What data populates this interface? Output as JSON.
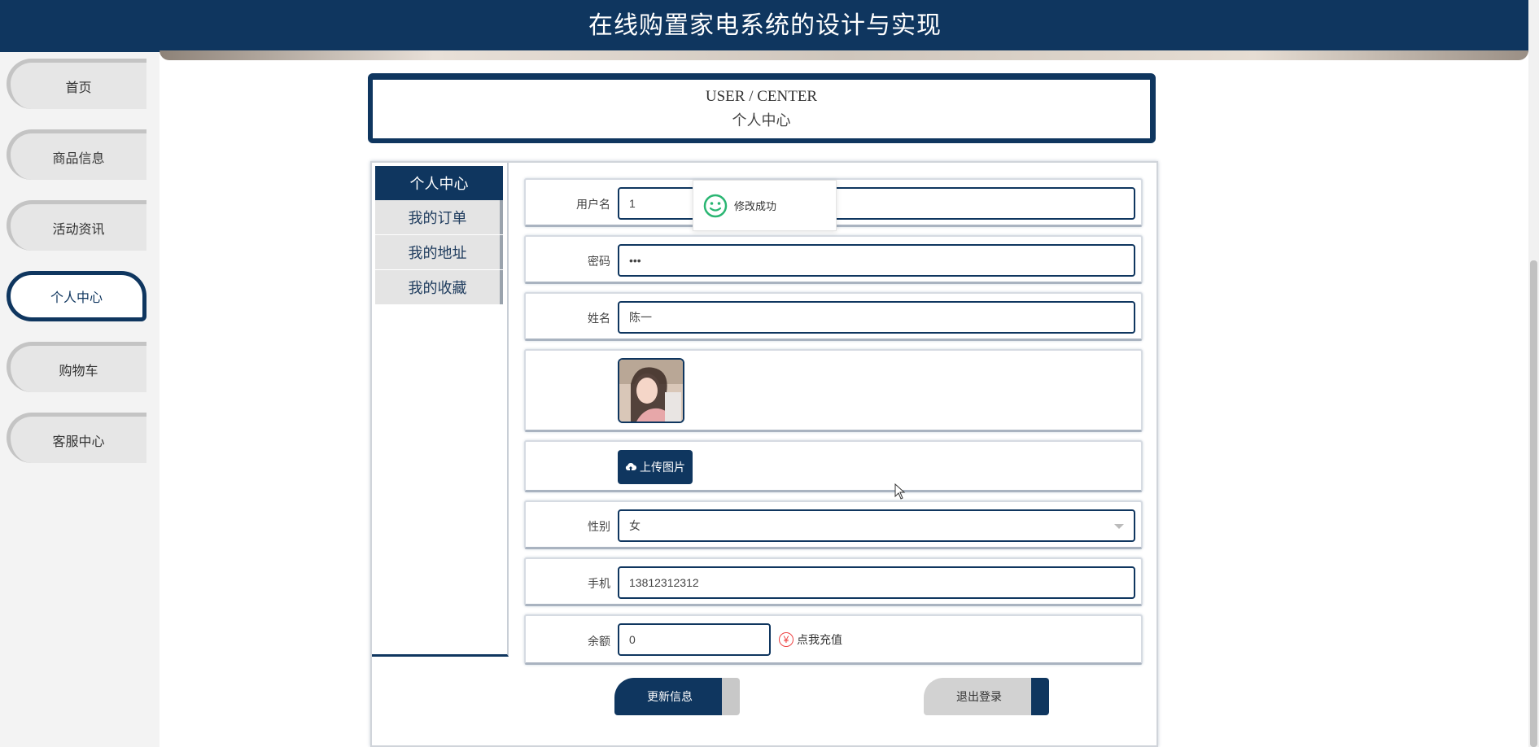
{
  "header": {
    "title": "在线购置家电系统的设计与实现"
  },
  "sidebar": {
    "items": [
      {
        "label": "首页",
        "active": false
      },
      {
        "label": "商品信息",
        "active": false
      },
      {
        "label": "活动资讯",
        "active": false
      },
      {
        "label": "个人中心",
        "active": true
      },
      {
        "label": "购物车",
        "active": false
      },
      {
        "label": "客服中心",
        "active": false
      }
    ]
  },
  "page_header": {
    "en": "USER / CENTER",
    "cn": "个人中心"
  },
  "menu": {
    "items": [
      {
        "label": "个人中心",
        "active": true
      },
      {
        "label": "我的订单",
        "active": false
      },
      {
        "label": "我的地址",
        "active": false
      },
      {
        "label": "我的收藏",
        "active": false
      }
    ]
  },
  "form": {
    "username": {
      "label": "用户名",
      "value": "1"
    },
    "password": {
      "label": "密码",
      "value": "•••"
    },
    "name": {
      "label": "姓名",
      "value": "陈一"
    },
    "upload_label": "上传图片",
    "gender": {
      "label": "性别",
      "value": "女"
    },
    "phone": {
      "label": "手机",
      "value": "13812312312"
    },
    "balance": {
      "label": "余额",
      "value": "0",
      "recharge_label": "点我充值",
      "yen_symbol": "¥"
    }
  },
  "actions": {
    "update_label": "更新信息",
    "logout_label": "退出登录"
  },
  "toast": {
    "message": "修改成功"
  },
  "colors": {
    "primary": "#0f365f",
    "toast_icon": "#2bb673"
  }
}
